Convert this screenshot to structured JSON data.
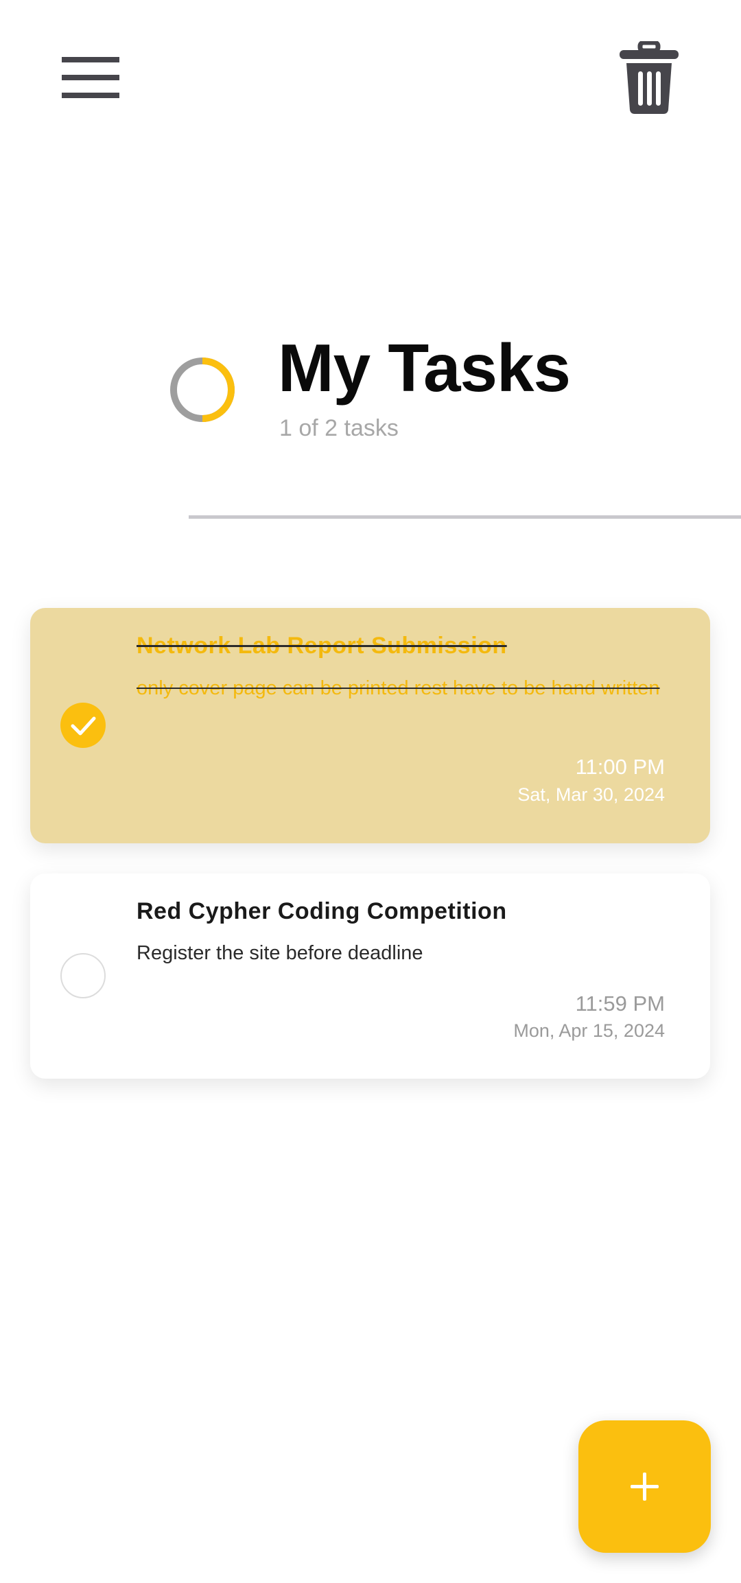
{
  "toolbar": {
    "menu_icon": "hamburger-menu-icon",
    "delete_icon": "trash-icon"
  },
  "header": {
    "title": "My Tasks",
    "count_text": "1 of 2 tasks",
    "progress": {
      "completed": 1,
      "total": 2,
      "done_color": "#fbbf0f",
      "remaining_color": "#9e9e9e"
    }
  },
  "tasks": [
    {
      "title": "Network Lab Report Submission",
      "description": "only cover page can be printed rest have to be hand written",
      "time": "11:00 PM",
      "date": "Sat, Mar 30, 2024",
      "completed": true
    },
    {
      "title": "Red Cypher Coding Competition",
      "description": "Register the site before deadline",
      "time": "11:59 PM",
      "date": "Mon, Apr 15, 2024",
      "completed": false
    }
  ],
  "fab": {
    "icon": "plus-icon"
  },
  "colors": {
    "accent": "#fbbf0f",
    "completed_card": "#ecd99f",
    "icon_gray": "#46454b"
  }
}
